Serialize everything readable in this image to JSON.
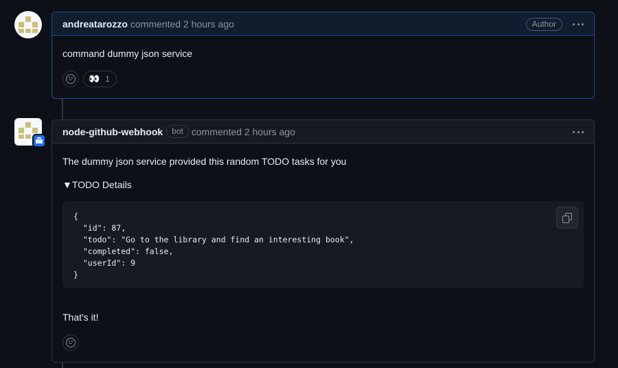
{
  "comments": [
    {
      "author": "andreatarozzo",
      "meta": "commented 2 hours ago",
      "badge": "Author",
      "body": "command dummy json service",
      "reactions": [
        {
          "emoji": "👀",
          "count": "1"
        }
      ]
    },
    {
      "author": "node-github-webhook",
      "bot_label": "bot",
      "meta": "commented 2 hours ago",
      "body": "The dummy json service provided this random TODO tasks for you",
      "details_summary": "▼TODO Details",
      "code": "{\n  \"id\": 87,\n  \"todo\": \"Go to the library and find an interesting book\",\n  \"completed\": false,\n  \"userId\": 9\n}",
      "closing": "That's it!"
    }
  ],
  "icons": {
    "reaction": "smiley-icon",
    "copy": "copy-icon",
    "menu": "kebab-icon"
  }
}
